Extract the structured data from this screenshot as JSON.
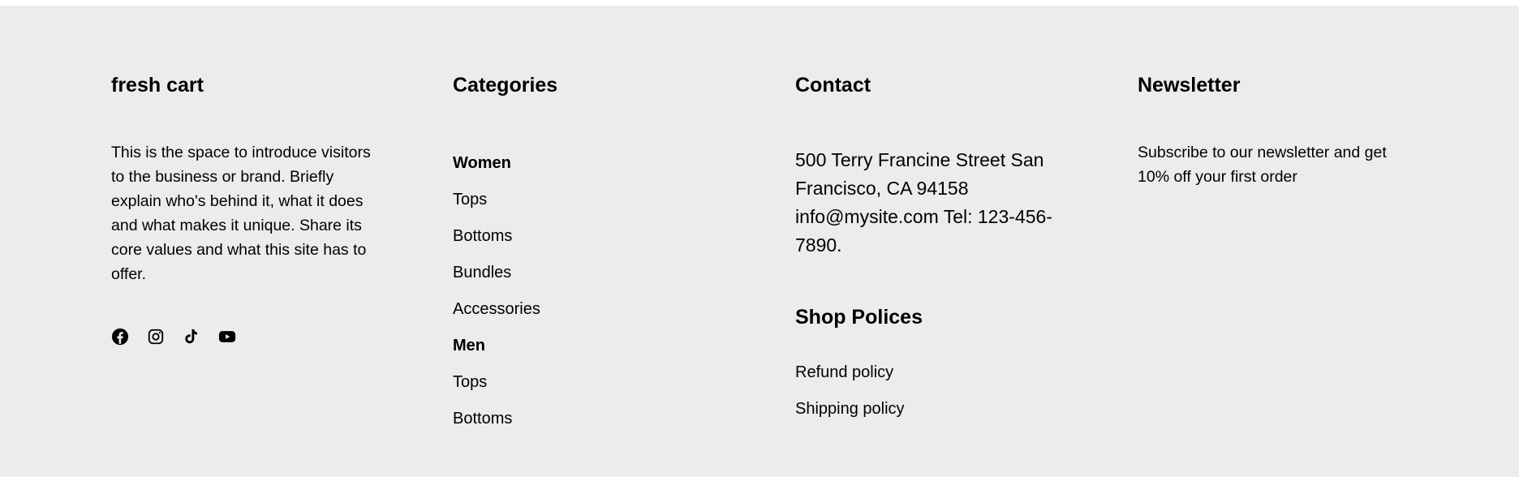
{
  "brand": {
    "title": "fresh cart",
    "description": "This is the space to introduce visitors to the business or brand. Briefly explain who's behind it, what it does and what makes it unique. Share its core values and what this site has to offer.",
    "social_icons": [
      "facebook-icon",
      "instagram-icon",
      "tiktok-icon",
      "youtube-icon"
    ]
  },
  "categories": {
    "title": "Categories",
    "items": [
      {
        "label": "Women",
        "group": true
      },
      {
        "label": "Tops",
        "group": false
      },
      {
        "label": "Bottoms",
        "group": false
      },
      {
        "label": "Bundles",
        "group": false
      },
      {
        "label": "Accessories",
        "group": false
      },
      {
        "label": "Men",
        "group": true
      },
      {
        "label": "Tops",
        "group": false
      },
      {
        "label": "Bottoms",
        "group": false
      }
    ]
  },
  "contact": {
    "title": "Contact",
    "address": "500 Terry Francine Street San Francisco, CA 94158 info@mysite.com Tel: 123-456-7890."
  },
  "policies": {
    "title": "Shop Polices",
    "items": [
      "Refund policy",
      "Shipping policy"
    ]
  },
  "newsletter": {
    "title": "Newsletter",
    "description": "Subscribe to our newsletter and get 10% off your first order"
  },
  "colors": {
    "footer_background": "#ececec",
    "page_background": "#ffffff",
    "text": "#000000"
  }
}
